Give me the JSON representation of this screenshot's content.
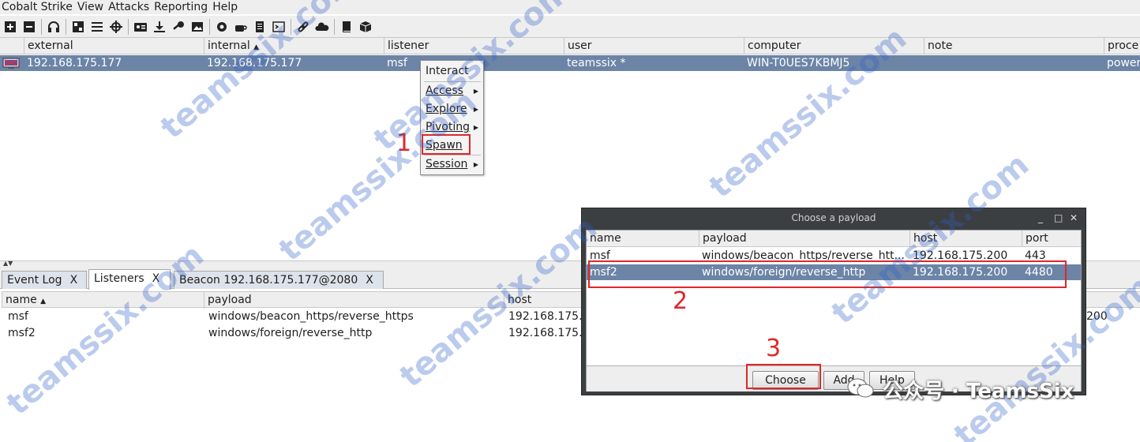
{
  "menu": [
    "Cobalt Strike",
    "View",
    "Attacks",
    "Reporting",
    "Help"
  ],
  "toolbar_icons": [
    "new-connection-icon",
    "disconnect-icon",
    "headphones-icon",
    "pivot-graph-icon",
    "session-table-icon",
    "target-icon",
    "credentials-icon",
    "download-icon",
    "key-icon",
    "screenshot-icon",
    "settings-icon",
    "coffee-icon",
    "document-icon",
    "console-icon",
    "link-icon",
    "cloud-icon",
    "book-icon",
    "package-icon"
  ],
  "beacon_table": {
    "columns": [
      "external",
      "internal",
      "listener",
      "user",
      "computer",
      "note",
      "proce"
    ],
    "sort_indicator": "▲",
    "rows": [
      {
        "external": "192.168.175.177",
        "internal": "192.168.175.177",
        "listener": "msf",
        "user": "teamssix *",
        "computer": "WIN-T0UES7KBMJ5",
        "note": "",
        "process": "power"
      }
    ]
  },
  "context_menu": [
    "Interact",
    "Access",
    "Explore",
    "Pivoting",
    "Spawn",
    "Session"
  ],
  "tabs": [
    {
      "label": "Event Log",
      "close": "X"
    },
    {
      "label": "Listeners",
      "close": "X"
    },
    {
      "label": "Beacon 192.168.175.177@2080",
      "close": "X"
    }
  ],
  "listeners_table": {
    "columns": [
      "name",
      "payload",
      "host"
    ],
    "sort_indicator": "▲",
    "rows": [
      {
        "name": "msf",
        "payload": "windows/beacon_https/reverse_https",
        "host": "192.168.175."
      },
      {
        "name": "msf2",
        "payload": "windows/foreign/reverse_http",
        "host": "192.168.175."
      }
    ],
    "cut_port_text": "200"
  },
  "dialog": {
    "title": "Choose a payload",
    "controls": [
      "_",
      "□",
      "✕"
    ],
    "columns": [
      "name",
      "payload",
      "host",
      "port"
    ],
    "rows": [
      {
        "name": "msf",
        "payload": "windows/beacon_https/reverse_htt...",
        "host": "192.168.175.200",
        "port": "443"
      },
      {
        "name": "msf2",
        "payload": "windows/foreign/reverse_http",
        "host": "192.168.175.200",
        "port": "4480"
      }
    ],
    "buttons": [
      "Choose",
      "Add",
      "Help"
    ]
  },
  "annotations": [
    "1",
    "2",
    "3"
  ],
  "watermark": "teamssix.com",
  "brand": "公众号 · TeamsSix",
  "colors": {
    "selection": "#6c84a6",
    "annotation": "#e0262a",
    "watermark": "#2f5fc8",
    "dialog_frame": "#3c3f41"
  }
}
